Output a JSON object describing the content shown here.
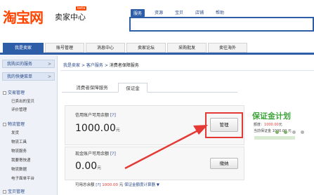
{
  "header": {
    "logo_text": "淘宝网",
    "logo_sub": "卖家中心",
    "logo_badge": "beta",
    "search_tabs": [
      "服务",
      "资源",
      "宝贝",
      "店铺",
      "帮助"
    ]
  },
  "nav": {
    "items": [
      "我是卖家",
      "账号管理",
      "消息中心",
      "卖家论坛",
      "采购批发",
      "卖往海外"
    ]
  },
  "sidebar": {
    "buttons": [
      "我购买的服务",
      "我的快捷菜单"
    ],
    "sections": [
      {
        "title": "交易管理",
        "links": [
          "已卖出的宝贝",
          "评价管理"
        ]
      },
      {
        "title": "物流管理",
        "links": [
          "发货",
          "物流工具",
          "物流服务",
          "我要寄快递",
          "物流数据",
          "电子面单平台"
        ]
      },
      {
        "title": "宝贝管理",
        "links": []
      }
    ]
  },
  "breadcrumb": {
    "items": [
      "我是卖家",
      "客户服务"
    ],
    "current": "消费者保障服务",
    "sep": ">"
  },
  "tabs": [
    "消费者保障服务",
    "保证金"
  ],
  "credit": {
    "label": "信用账户可用余额",
    "help": "[?]",
    "amount": "1000.00",
    "unit": "元",
    "button": "管理"
  },
  "cash": {
    "label": "现金账户可用余额",
    "help": "[?]",
    "amount": "0.00",
    "unit": "元",
    "button": "缴纳"
  },
  "footer": {
    "label": "可用总余额",
    "help": "[?]",
    "amount": "1000.00",
    "unit": "元",
    "link": "保证金额度计算器"
  },
  "right": {
    "brand": "保证金计划",
    "line1_label": "额度：",
    "line1_value": "1000.00",
    "line1_unit": "元",
    "line2": "当前保证金 1000.00 元"
  },
  "colors": {
    "accent": "#2f5ea8",
    "brand_orange": "#ff4400",
    "highlight_red": "#e53935",
    "brand_green": "#3fa53a"
  }
}
